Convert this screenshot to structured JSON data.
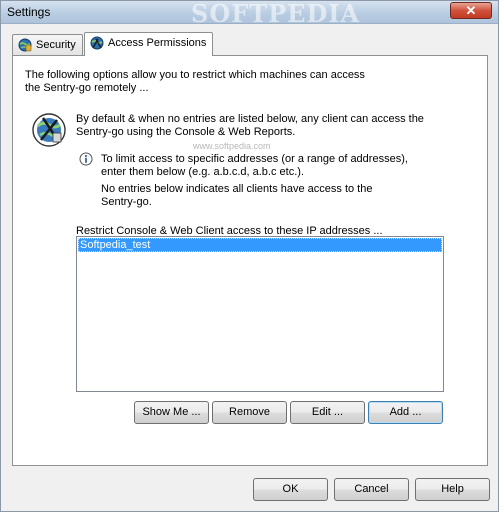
{
  "window": {
    "title": "Settings",
    "watermark": "SOFTPEDIA",
    "close_glyph": "✕"
  },
  "tabs": [
    {
      "label": "Security",
      "icon": "globe-shield-icon",
      "active": false
    },
    {
      "label": "Access Permissions",
      "icon": "globe-check-icon",
      "active": true
    }
  ],
  "content": {
    "intro_line1": "The following options allow you to restrict which machines can access",
    "intro_line2": "the Sentry-go remotely ...",
    "default_line1": "By default & when no entries are listed below, any client can access the",
    "default_line2": "Sentry-go using the Console & Web Reports.",
    "tip_line1": "To limit access to specific addresses (or a range of addresses),",
    "tip_line2": "enter them below (e.g. a.b.c.d, a.b.c etc.).",
    "note_line1": "No entries below indicates all clients have access to the",
    "note_line2": "Sentry-go.",
    "list_label": "Restrict Console & Web Client access to these IP addresses ...",
    "watermark_small": "www.softpedia.com"
  },
  "ip_list": {
    "items": [
      "Softpedia_test"
    ],
    "selected_index": 0
  },
  "list_buttons": {
    "show_me": "Show Me ...",
    "remove": "Remove",
    "edit": "Edit ...",
    "add": "Add ..."
  },
  "dialog_buttons": {
    "ok": "OK",
    "cancel": "Cancel",
    "help": "Help"
  },
  "colors": {
    "selection": "#3399ff",
    "close_button": "#c13a22"
  }
}
